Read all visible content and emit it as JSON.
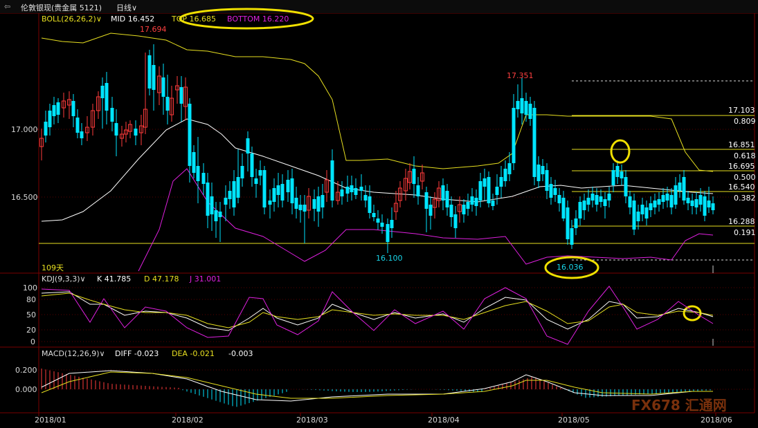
{
  "window": {
    "title": "伦敦银现(贵金属 5121)",
    "period": "日线"
  },
  "colors": {
    "up": "#ff3b3b",
    "down": "#00e5ff",
    "mid": "#ffffff",
    "top": "#e8e020",
    "bottom": "#e020e0",
    "frame": "#7a0000"
  },
  "boll": {
    "label": "BOLL(26,26,2)",
    "mid": "MID 16.452",
    "top": "TOP 16.685",
    "bottom": "BOTTOM 16.220"
  },
  "price_axis": [
    "17.000",
    "16.500"
  ],
  "annotations": {
    "high1": "17.694",
    "high2": "17.351",
    "low1": "16.100",
    "low2": "16.036",
    "days": "109天"
  },
  "fib_levels": [
    {
      "price": "17.103",
      "ratio": "0.809"
    },
    {
      "price": "16.851",
      "ratio": "0.618"
    },
    {
      "price": "16.695",
      "ratio": "0.500"
    },
    {
      "price": "16.540",
      "ratio": "0.382"
    },
    {
      "price": "16.288",
      "ratio": "0.191"
    }
  ],
  "kdj": {
    "label": "KDJ(9,3,3)",
    "k": "K 41.785",
    "d": "D 47.178",
    "j": "J 31.001",
    "axis": [
      "100",
      "80",
      "50",
      "20",
      "0"
    ]
  },
  "macd": {
    "label": "MACD(12,26,9)",
    "diff": "DIFF -0.023",
    "dea": "DEA -0.021",
    "value": "-0.003",
    "axis": [
      "0.200",
      "0.000"
    ]
  },
  "x_axis": [
    "2018/01",
    "2018/02",
    "2018/03",
    "2018/04",
    "2018/05",
    "2018/06"
  ],
  "watermark": "FX678 汇通网"
}
